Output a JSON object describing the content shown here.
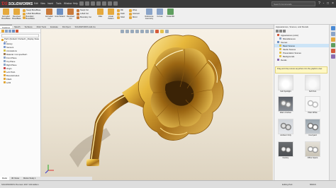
{
  "app": {
    "logo_text": "SOLIDWORKS",
    "menus": [
      "File",
      "Edit",
      "View",
      "Insert",
      "Tools",
      "Window",
      "Help"
    ],
    "search_placeholder": "Search Commands",
    "window_controls": [
      "?",
      "-",
      "□",
      "×"
    ]
  },
  "ribbon": {
    "large_tools": [
      {
        "label": "Extruded Boss/Base",
        "icon": "extrude-boss-icon",
        "color": "#e5a93d"
      },
      {
        "label": "Revolved Boss/Base",
        "icon": "revolve-boss-icon",
        "color": "#e5a93d"
      },
      {
        "label": "Extruded Cut",
        "icon": "extrude-cut-icon",
        "color": "#c97a3a"
      },
      {
        "label": "Hole Wizard",
        "icon": "hole-wizard-icon",
        "color": "#6d8fc2"
      },
      {
        "label": "Revolved Cut",
        "icon": "revolve-cut-icon",
        "color": "#c97a3a"
      },
      {
        "label": "Fillet",
        "icon": "fillet-icon",
        "color": "#e5a93d"
      },
      {
        "label": "Linear Pattern",
        "icon": "linear-pattern-icon",
        "color": "#e5a93d"
      },
      {
        "label": "Rib",
        "icon": "rib-icon",
        "color": "#e5a93d"
      },
      {
        "label": "Draft",
        "icon": "draft-icon",
        "color": "#e5a93d"
      },
      {
        "label": "Wrap",
        "icon": "wrap-icon",
        "color": "#e5a93d"
      },
      {
        "label": "Reference Geometry",
        "icon": "reference-geometry-icon",
        "color": "#8aa4c8"
      },
      {
        "label": "Curves",
        "icon": "curves-icon",
        "color": "#8aa4c8"
      },
      {
        "label": "Instant3D",
        "icon": "instant3d-icon",
        "color": "#5f9e5f"
      }
    ],
    "small_tools": [
      {
        "label": "Swept Boss/Base",
        "color": "#e5a93d"
      },
      {
        "label": "Lofted Boss/Base",
        "color": "#e5a93d"
      },
      {
        "label": "Boundary Boss/Base",
        "color": "#e5a93d"
      },
      {
        "label": "Swept Cut",
        "color": "#c97a3a"
      },
      {
        "label": "Lofted Cut",
        "color": "#c97a3a"
      },
      {
        "label": "Boundary Cut",
        "color": "#c97a3a"
      },
      {
        "label": "Shell",
        "color": "#e5a93d"
      },
      {
        "label": "Intersect",
        "color": "#e5a93d"
      },
      {
        "label": "Mirror",
        "color": "#e5a93d"
      }
    ]
  },
  "command_tabs": [
    "Features",
    "Sketch",
    "Surfaces",
    "Mold Tools",
    "Evaluate",
    "DimXpert",
    "SOLIDWORKS Add-Ins"
  ],
  "feature_tree": {
    "items": [
      "Part1 (Default<<Default>_Display State 1>)",
      "History",
      "Sensors",
      "Annotations",
      "Material <not specified>",
      "Front Plane",
      "Top Plane",
      "Right Plane",
      "Origin",
      "Loft-Thin1",
      "Boss-Extrude1",
      "Fillet1",
      "Loft2"
    ]
  },
  "task_pane": {
    "title": "Appearances, Scenes, and Decals",
    "tree": [
      {
        "label": "Appearances (color)",
        "color": "#d45a3a",
        "selected": false
      },
      {
        "label": "Miscellaneous",
        "color": "#8aa4c8",
        "selected": false
      },
      {
        "label": "Scenes",
        "color": "#6d8fc2",
        "selected": false
      },
      {
        "label": "Basic Scenes",
        "color": "#e5c24a",
        "selected": true
      },
      {
        "label": "Studio Scenes",
        "color": "#e5c24a",
        "selected": false
      },
      {
        "label": "Presentation Scenes",
        "color": "#e5c24a",
        "selected": false
      },
      {
        "label": "Backgrounds",
        "color": "#e5c24a",
        "selected": false
      },
      {
        "label": "Decals",
        "color": "#8a6bb0",
        "selected": false
      }
    ],
    "hint": "Drag and drop scenes anywhere into the graphics view.",
    "thumbs": [
      {
        "label": "Soft Spotlight"
      },
      {
        "label": "Soft Tent"
      },
      {
        "label": "Warm Kitchen"
      },
      {
        "label": "Plain White"
      },
      {
        "label": "Ambient Only"
      },
      {
        "label": "Courtyard"
      },
      {
        "label": "Factory"
      },
      {
        "label": "Office Space"
      }
    ]
  },
  "bottom_tabs": [
    "Model",
    "3D Views",
    "Motion Study 1"
  ],
  "status": {
    "left": "SOLIDWORKS Premium 2017 x64 Edition",
    "mode": "Editing Part",
    "units": "MMGS"
  }
}
